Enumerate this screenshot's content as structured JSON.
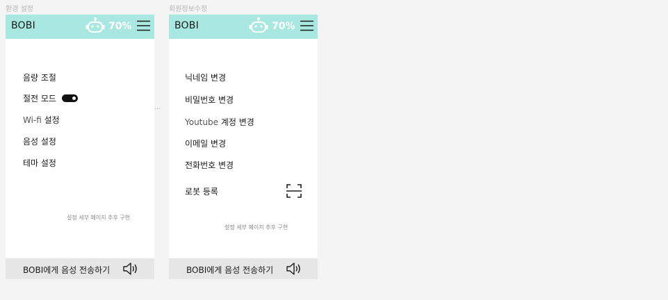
{
  "screens": [
    {
      "caption": "환경 설정",
      "header": {
        "brand": "BOBI",
        "battery": "70%"
      },
      "menu": [
        {
          "label": "음량 조절"
        },
        {
          "label": "절전 모드",
          "toggle_on": true
        },
        {
          "label_prefix": "Wi-fi",
          "label": " 설정"
        },
        {
          "label": "음성 설정"
        },
        {
          "label": "테마 설정"
        }
      ],
      "note": "설정 세부 페이지 추후 구현",
      "ellipsis": "...",
      "bottom_label": "BOBI에게 음성 전송하기"
    },
    {
      "caption": "회원정보수정",
      "header": {
        "brand": "BOBI",
        "battery": "70%"
      },
      "menu": [
        {
          "label": "닉네임 변경"
        },
        {
          "label": "비밀번호 변경"
        },
        {
          "label_prefix": "Youtube",
          "label": " 계정 변경"
        },
        {
          "label": "이메일 변경"
        },
        {
          "label": "전화번호 변경"
        },
        {
          "label": "로봇 등록"
        }
      ],
      "note": "설정 세부 페이지 추후 구현",
      "bottom_label": "BOBI에게 음성 전송하기"
    }
  ],
  "colors": {
    "header_bg": "#a8e8e0",
    "bottom_bar_bg": "#e6e6e6",
    "page_bg": "#f4f4f4"
  },
  "icons": [
    "robot-icon",
    "menu-icon",
    "toggle-switch",
    "speaker-icon",
    "scan-icon"
  ]
}
